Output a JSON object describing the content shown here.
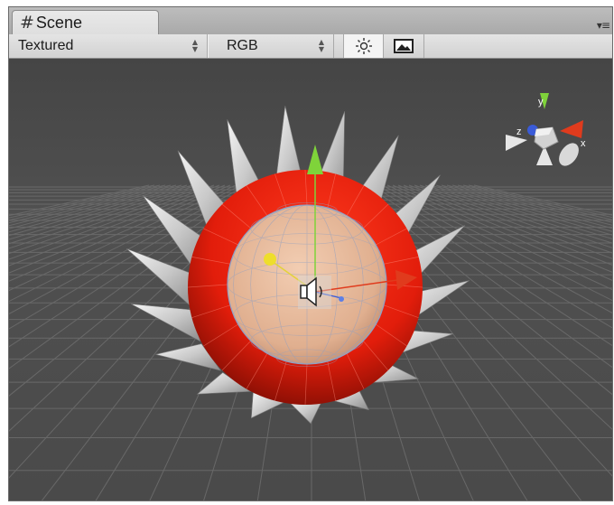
{
  "window": {
    "tab_title": "Scene",
    "tab_icon": "scene-hash-icon",
    "menu_icon": "window-menu-icon"
  },
  "toolbar": {
    "render_mode": "Textured",
    "color_mode": "RGB",
    "lighting_icon": "sun-icon",
    "skybox_icon": "image-icon"
  },
  "gizmo": {
    "x_label": "x",
    "y_label": "y",
    "z_label": "z"
  },
  "colors": {
    "background": "#484848",
    "grid": "#6a6a6a",
    "ring": "#e8220f",
    "sphere": "#e6b79a",
    "spike": "#cfcfcf",
    "y_axis": "#7fd33a",
    "x_axis": "#e03b1d",
    "z_axis": "#3a5bd8"
  }
}
